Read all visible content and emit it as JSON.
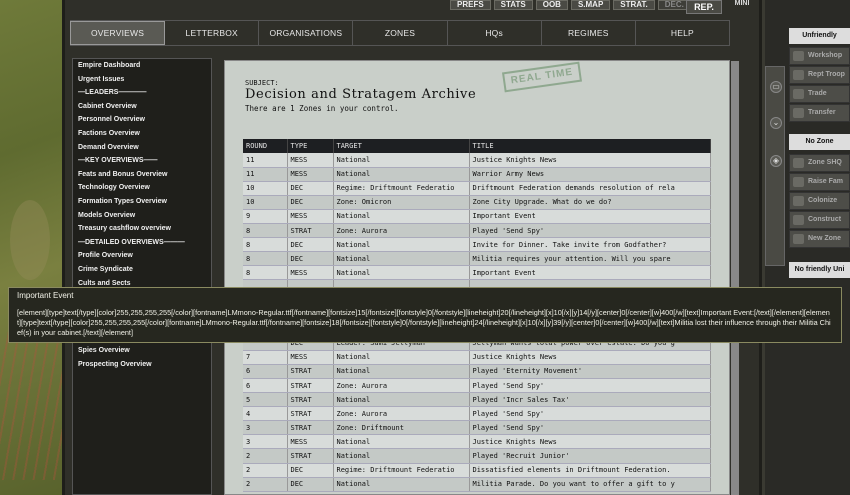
{
  "top_buttons": [
    "PREFS",
    "STATS",
    "OOB",
    "S.MAP",
    "STRAT.",
    "DEC."
  ],
  "rep_label": "REP.",
  "mini_label": "MINI",
  "tabs": [
    {
      "label": "OVERVIEWS",
      "active": true
    },
    {
      "label": "LETTERBOX"
    },
    {
      "label": "ORGANISATIONS"
    },
    {
      "label": "ZONES"
    },
    {
      "label": "HQs"
    },
    {
      "label": "REGIMES"
    },
    {
      "label": "HELP"
    }
  ],
  "nav": [
    "Empire Dashboard",
    "Urgent Issues",
    "—LEADERS————",
    "Cabinet Overview",
    "Personnel Overview",
    "Factions Overview",
    "Demand Overview",
    "—KEY OVERVIEWS——",
    "Feats and Bonus Overview",
    "Technology Overview",
    "Formation Types Overview",
    "Models Overview",
    "Treasury cashflow overview",
    "—DETAILED OVERVIEWS———",
    "Profile Overview",
    "Crime Syndicate",
    "Cults and Sects",
    "",
    "",
    "",
    "",
    "Spies Overview",
    "Prospecting Overview"
  ],
  "doc": {
    "subject": "SUBJECT:",
    "title": "Decision and Stratagem Archive",
    "subtitle": "There are 1 Zones in your control.",
    "stamp": "REAL TIME",
    "columns": [
      "ROUND",
      "TYPE",
      "TARGET",
      "TITLE"
    ],
    "rows": [
      [
        "11",
        "MESS",
        "National",
        "Justice Knights News"
      ],
      [
        "11",
        "MESS",
        "National",
        "Warrior Army News"
      ],
      [
        "10",
        "DEC",
        "Regime: Driftmount Federatio",
        "Driftmount Federation demands resolution of rela"
      ],
      [
        "10",
        "DEC",
        "Zone: Omicron",
        "Zone City Upgrade. What do we do?"
      ],
      [
        "9",
        "MESS",
        "National",
        "Important Event"
      ],
      [
        "8",
        "STRAT",
        "Zone: Aurora",
        "Played 'Send Spy'"
      ],
      [
        "8",
        "DEC",
        "National",
        "Invite for Dinner. Take invite from Godfather?"
      ],
      [
        "8",
        "DEC",
        "National",
        "Militia requires your attention. Will you spare"
      ],
      [
        "8",
        "MESS",
        "National",
        "Important Event"
      ],
      [
        "",
        "",
        "",
        ""
      ],
      [
        "",
        "",
        "",
        ""
      ],
      [
        "",
        "",
        "",
        ""
      ],
      [
        "",
        "",
        "",
        ""
      ],
      [
        "",
        "DEC",
        "Leader: Sami Jellyman",
        "Jellyman wants total power over estate. Do you g"
      ],
      [
        "7",
        "MESS",
        "National",
        "Justice Knights News"
      ],
      [
        "6",
        "STRAT",
        "National",
        "Played 'Eternity Movement'"
      ],
      [
        "6",
        "STRAT",
        "Zone: Aurora",
        "Played 'Send Spy'"
      ],
      [
        "5",
        "STRAT",
        "National",
        "Played 'Incr Sales Tax'"
      ],
      [
        "4",
        "STRAT",
        "Zone: Aurora",
        "Played 'Send Spy'"
      ],
      [
        "3",
        "STRAT",
        "Zone: Driftmount",
        "Played 'Send Spy'"
      ],
      [
        "3",
        "MESS",
        "National",
        "Justice Knights News"
      ],
      [
        "2",
        "STRAT",
        "National",
        "Played 'Recruit Junior'"
      ],
      [
        "2",
        "DEC",
        "Regime: Driftmount Federatio",
        "Dissatisfied elements in Driftmount Federation."
      ],
      [
        "2",
        "DEC",
        "National",
        "Militia Parade. Do you want to offer a gift to y"
      ]
    ]
  },
  "right_panel": {
    "header1": "Unfriendly",
    "buttons1": [
      "Workshop",
      "Rept Troop",
      "Trade",
      "Transfer"
    ],
    "header2": "No Zone",
    "buttons2": [
      "Zone SHQ",
      "Raise Fam",
      "Colonize",
      "Construct",
      "New Zone"
    ],
    "header3": "No friendly Uni"
  },
  "tooltip": {
    "title": "Important Event",
    "body": "[element][type]text[/type][color]255,255,255,255[/color][fontname]LMmono-Regular.ttf[/fontname][fontsize]15[/fontsize][fontstyle]0[/fontstyle][lineheight]20[/lineheight][x]10[/x][y]14[/y][center]0[/center][w]400[/w][text]Important Event:[/text][/element][element][type]text[/type][color]255,255,255,255[/color][fontname]LMmono-Regular.ttf[/fontname][fontsize]18[/fontsize][fontstyle]0[/fontstyle][lineheight]24[/lineheight][x]10[/x][y]39[/y][center]0[/center][w]400[/w][text]Militia lost their influence through their Militia Chief(s) in your cabinet.[/text][/element]"
  }
}
